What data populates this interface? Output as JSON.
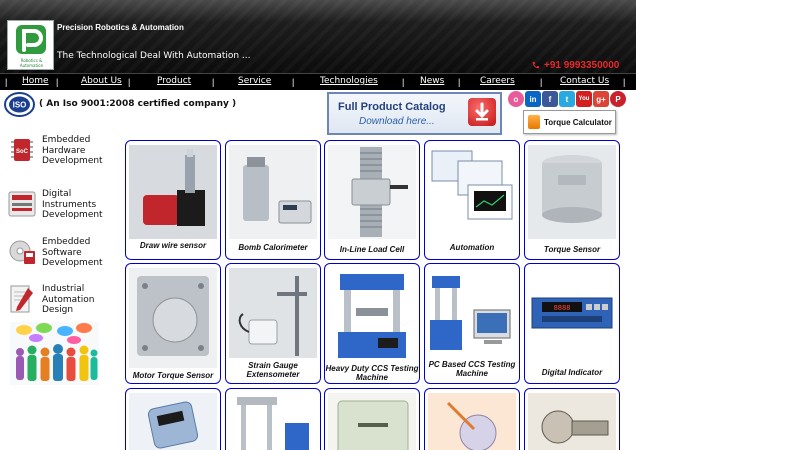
{
  "header": {
    "company_name": "Precision Robotics & Automation",
    "tagline": "The Technological Deal With Automation ...",
    "phone": "+91 9993350000",
    "logo_text": "Robotics & Automation",
    "colors": {
      "phone": "#e8282a",
      "logo_green": "#2f9a3e"
    }
  },
  "nav": {
    "items": [
      {
        "label": "Home"
      },
      {
        "label": "About Us"
      },
      {
        "label": "Product"
      },
      {
        "label": "Service"
      },
      {
        "label": "Technologies"
      },
      {
        "label": "News"
      },
      {
        "label": "Careers"
      },
      {
        "label": "Contact Us"
      }
    ],
    "separator": "|"
  },
  "iso": {
    "text": "( An Iso 9001:2008 certified company )"
  },
  "catalog": {
    "title": "Full Product Catalog",
    "subtitle": "Download here..."
  },
  "social": {
    "icons": [
      {
        "name": "orkut-icon",
        "glyph": "o",
        "color": "#e85a9a"
      },
      {
        "name": "linkedin-icon",
        "glyph": "in",
        "color": "#0a66c2"
      },
      {
        "name": "facebook-icon",
        "glyph": "f",
        "color": "#3b5998"
      },
      {
        "name": "twitter-icon",
        "glyph": "t",
        "color": "#2aa9e0"
      },
      {
        "name": "youtube-icon",
        "glyph": "You",
        "color": "#d21f1f"
      },
      {
        "name": "google-plus-icon",
        "glyph": "g+",
        "color": "#db4437"
      },
      {
        "name": "pinterest-icon",
        "glyph": "P",
        "color": "#c8232c"
      }
    ]
  },
  "torque_calculator": {
    "label": "Torque Calculator"
  },
  "sidebar": {
    "items": [
      {
        "label": "Embedded Hardware Development",
        "icon": "soc-chip-icon"
      },
      {
        "label": "Digital Instruments Development",
        "icon": "digital-instrument-icon"
      },
      {
        "label": "Embedded Software Development",
        "icon": "software-disc-icon"
      },
      {
        "label": "Industrial Automation Design",
        "icon": "automation-design-icon"
      }
    ]
  },
  "products": [
    {
      "caption": "Draw wire sensor"
    },
    {
      "caption": "Bomb Calorimeter"
    },
    {
      "caption": "In-Line Load Cell"
    },
    {
      "caption": "Automation"
    },
    {
      "caption": "Torque Sensor"
    },
    {
      "caption": "Motor Torque Sensor"
    },
    {
      "caption": "Strain Gauge Extensometer"
    },
    {
      "caption": "Heavy Duty CCS Testing Machine"
    },
    {
      "caption": "PC Based CCS Testing Machine"
    },
    {
      "caption": "Digital Indicator"
    },
    {
      "caption": ""
    },
    {
      "caption": ""
    },
    {
      "caption": ""
    },
    {
      "caption": ""
    },
    {
      "caption": ""
    }
  ],
  "card_border_color": "#0000cc"
}
